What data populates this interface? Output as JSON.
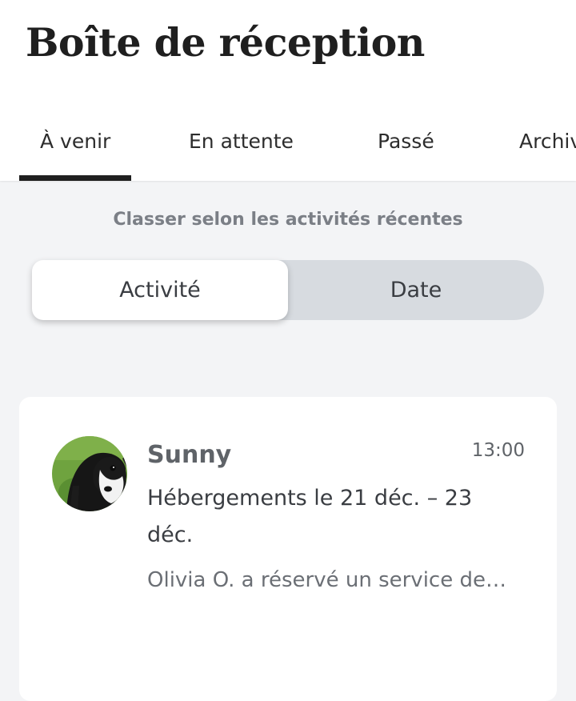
{
  "header": {
    "title": "Boîte de réception"
  },
  "tabs": [
    {
      "label": "À venir",
      "active": true
    },
    {
      "label": "En attente",
      "active": false
    },
    {
      "label": "Passé",
      "active": false
    },
    {
      "label": "Archivé",
      "active": false
    }
  ],
  "sort": {
    "caption": "Classer selon les activités récentes",
    "options": [
      {
        "label": "Activité",
        "selected": true
      },
      {
        "label": "Date",
        "selected": false
      }
    ]
  },
  "conversations": [
    {
      "sender": "Sunny",
      "time": "13:00",
      "subject": "Hébergements le 21 déc. – 23 déc.",
      "preview": "Olivia O. a réservé un service de…",
      "avatar_icon": "dog-photo-avatar"
    }
  ],
  "colors": {
    "background": "#f3f4f6",
    "active_tab_indicator": "#1f1f1f",
    "segment_track": "#d7dbe0",
    "muted_text": "#7b7f86"
  }
}
